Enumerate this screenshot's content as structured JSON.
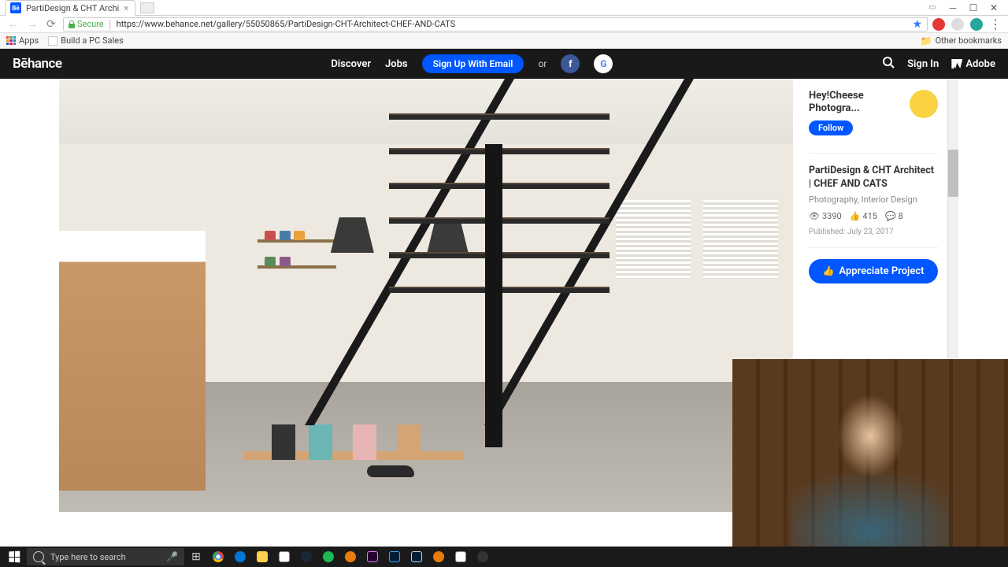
{
  "browser": {
    "tab_title": "PartiDesign & CHT Archi",
    "security": "Secure",
    "url": "https://www.behance.net/gallery/55050865/PartiDesign-CHT-Architect-CHEF-AND-CATS",
    "bookmarks": {
      "apps": "Apps",
      "items": [
        "Build a PC Sales"
      ],
      "other": "Other bookmarks"
    }
  },
  "behance_nav": {
    "logo": "Bēhance",
    "discover": "Discover",
    "jobs": "Jobs",
    "signup": "Sign Up With Email",
    "or": "or",
    "signin": "Sign In",
    "adobe": "Adobe"
  },
  "sidebar": {
    "author": "Hey!Cheese Photogra...",
    "follow": "Follow",
    "project_title": "PartiDesign & CHT Architect | CHEF AND CATS",
    "categories": "Photography, Interior Design",
    "views": "3390",
    "likes": "415",
    "comments": "8",
    "published": "Published: July 23, 2017",
    "appreciate": "Appreciate Project"
  },
  "taskbar": {
    "search_placeholder": "Type here to search"
  },
  "colors": {
    "primary": "#0057ff",
    "nav_bg": "#191919"
  }
}
